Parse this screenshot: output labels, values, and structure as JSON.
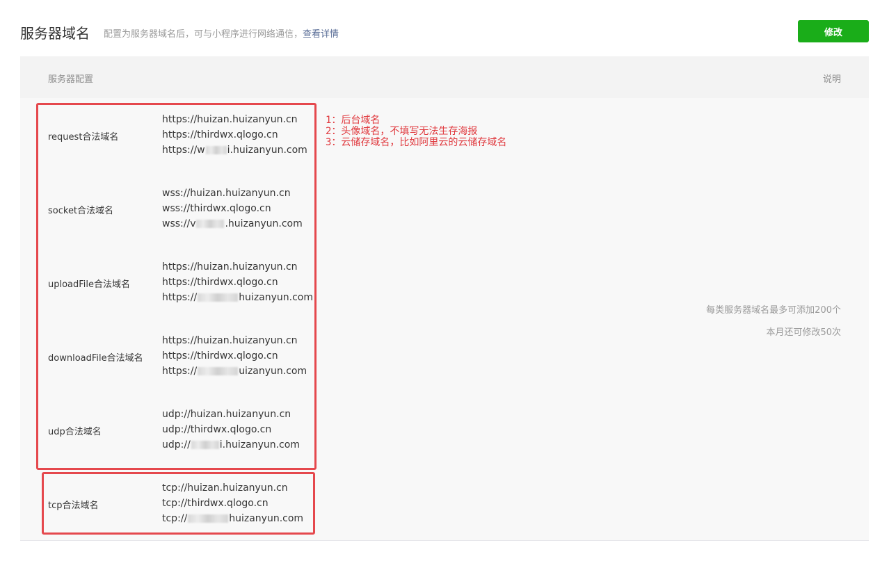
{
  "header": {
    "title": "服务器域名",
    "description": "配置为服务器域名后，可与小程序进行网络通信，",
    "detail_link": "查看详情",
    "modify_button": "修改"
  },
  "table": {
    "col_config": "服务器配置",
    "col_note": "说明",
    "rows": [
      {
        "label": "request合法域名",
        "urls": [
          "https://huizan.huizanyun.cn",
          "https://thirdwx.qlogo.cn"
        ],
        "redacted_prefix": "https://w",
        "redacted_suffix": "i.huizanyun.com"
      },
      {
        "label": "socket合法域名",
        "urls": [
          "wss://huizan.huizanyun.cn",
          "wss://thirdwx.qlogo.cn"
        ],
        "redacted_prefix": "wss://v",
        "redacted_suffix": ".huizanyun.com"
      },
      {
        "label": "uploadFile合法域名",
        "urls": [
          "https://huizan.huizanyun.cn",
          "https://thirdwx.qlogo.cn"
        ],
        "redacted_prefix": "https://",
        "redacted_suffix": "huizanyun.com"
      },
      {
        "label": "downloadFile合法域名",
        "urls": [
          "https://huizan.huizanyun.cn",
          "https://thirdwx.qlogo.cn"
        ],
        "redacted_prefix": "https://",
        "redacted_suffix": "uizanyun.com"
      },
      {
        "label": "udp合法域名",
        "urls": [
          "udp://huizan.huizanyun.cn",
          "udp://thirdwx.qlogo.cn"
        ],
        "redacted_prefix": "udp://",
        "redacted_suffix": "i.huizanyun.com"
      },
      {
        "label": "tcp合法域名",
        "urls": [
          "tcp://huizan.huizanyun.cn",
          "tcp://thirdwx.qlogo.cn"
        ],
        "redacted_prefix": "tcp://",
        "redacted_suffix": "huizanyun.com"
      }
    ],
    "info_limit": "每类服务器域名最多可添加200个",
    "info_quota": "本月还可修改50次"
  },
  "annotations": {
    "notes": [
      "1：后台域名",
      "2：头像域名，不填写无法生存海报",
      "3：云储存域名，比如阿里云的云储存域名"
    ],
    "color": "#e5484d"
  },
  "colors": {
    "accent_green": "#1aad19",
    "link_blue": "#576b95"
  }
}
